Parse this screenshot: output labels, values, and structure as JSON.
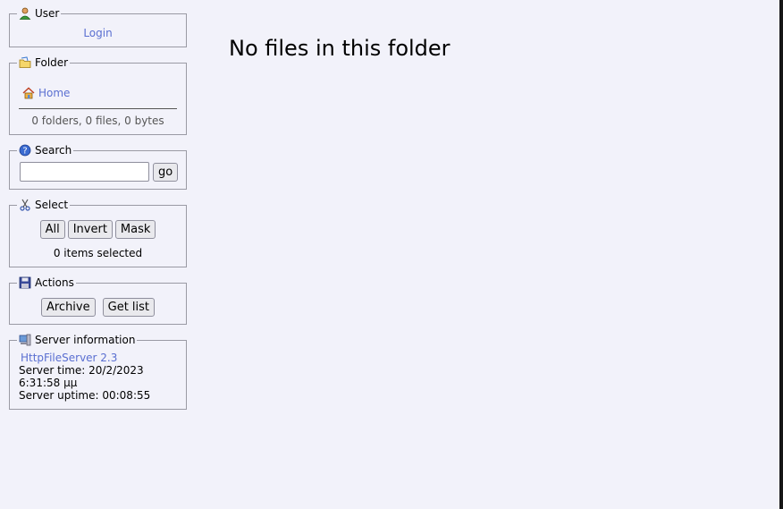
{
  "user": {
    "title": "User",
    "login_link": "Login"
  },
  "folder": {
    "title": "Folder",
    "home_link": "Home",
    "stats": "0 folders, 0 files, 0 bytes"
  },
  "search": {
    "title": "Search",
    "value": "",
    "go_button": "go"
  },
  "select": {
    "title": "Select",
    "buttons": {
      "all": "All",
      "invert": "Invert",
      "mask": "Mask"
    },
    "status": "0 items selected"
  },
  "actions": {
    "title": "Actions",
    "archive_button": "Archive",
    "get_list_button": "Get list"
  },
  "server": {
    "title": "Server information",
    "version_link": "HttpFileServer 2.3",
    "time": "Server time: 20/2/2023 6:31:58 μμ",
    "uptime": "Server uptime: 00:08:55"
  },
  "main": {
    "message": "No files in this folder"
  },
  "icons": {
    "user": "user-icon",
    "folder": "folder-icon",
    "home": "home-icon",
    "search": "help-question-icon",
    "select": "scissors-icon",
    "actions": "floppy-disk-icon",
    "server": "server-computer-icon"
  }
}
